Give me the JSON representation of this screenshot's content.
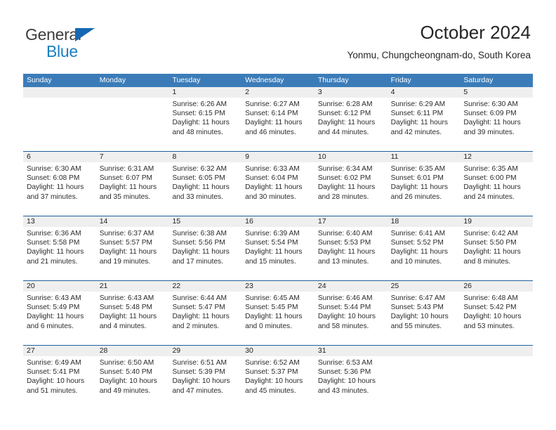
{
  "brand": {
    "name_part1": "General",
    "name_part2": "Blue",
    "triangle_color": "#1668b3",
    "blue_text_color": "#1a7fc1"
  },
  "header": {
    "title": "October 2024",
    "subtitle": "Yonmu, Chungcheongnam-do, South Korea"
  },
  "colors": {
    "header_blue": "#3b7cb8",
    "week_divider": "#20619e",
    "daynum_band": "#efefef"
  },
  "weekdays": [
    "Sunday",
    "Monday",
    "Tuesday",
    "Wednesday",
    "Thursday",
    "Friday",
    "Saturday"
  ],
  "weeks": [
    [
      {
        "day": "",
        "sunrise": "",
        "sunset": "",
        "daylight1": "",
        "daylight2": ""
      },
      {
        "day": "",
        "sunrise": "",
        "sunset": "",
        "daylight1": "",
        "daylight2": ""
      },
      {
        "day": "1",
        "sunrise": "Sunrise: 6:26 AM",
        "sunset": "Sunset: 6:15 PM",
        "daylight1": "Daylight: 11 hours",
        "daylight2": "and 48 minutes."
      },
      {
        "day": "2",
        "sunrise": "Sunrise: 6:27 AM",
        "sunset": "Sunset: 6:14 PM",
        "daylight1": "Daylight: 11 hours",
        "daylight2": "and 46 minutes."
      },
      {
        "day": "3",
        "sunrise": "Sunrise: 6:28 AM",
        "sunset": "Sunset: 6:12 PM",
        "daylight1": "Daylight: 11 hours",
        "daylight2": "and 44 minutes."
      },
      {
        "day": "4",
        "sunrise": "Sunrise: 6:29 AM",
        "sunset": "Sunset: 6:11 PM",
        "daylight1": "Daylight: 11 hours",
        "daylight2": "and 42 minutes."
      },
      {
        "day": "5",
        "sunrise": "Sunrise: 6:30 AM",
        "sunset": "Sunset: 6:09 PM",
        "daylight1": "Daylight: 11 hours",
        "daylight2": "and 39 minutes."
      }
    ],
    [
      {
        "day": "6",
        "sunrise": "Sunrise: 6:30 AM",
        "sunset": "Sunset: 6:08 PM",
        "daylight1": "Daylight: 11 hours",
        "daylight2": "and 37 minutes."
      },
      {
        "day": "7",
        "sunrise": "Sunrise: 6:31 AM",
        "sunset": "Sunset: 6:07 PM",
        "daylight1": "Daylight: 11 hours",
        "daylight2": "and 35 minutes."
      },
      {
        "day": "8",
        "sunrise": "Sunrise: 6:32 AM",
        "sunset": "Sunset: 6:05 PM",
        "daylight1": "Daylight: 11 hours",
        "daylight2": "and 33 minutes."
      },
      {
        "day": "9",
        "sunrise": "Sunrise: 6:33 AM",
        "sunset": "Sunset: 6:04 PM",
        "daylight1": "Daylight: 11 hours",
        "daylight2": "and 30 minutes."
      },
      {
        "day": "10",
        "sunrise": "Sunrise: 6:34 AM",
        "sunset": "Sunset: 6:02 PM",
        "daylight1": "Daylight: 11 hours",
        "daylight2": "and 28 minutes."
      },
      {
        "day": "11",
        "sunrise": "Sunrise: 6:35 AM",
        "sunset": "Sunset: 6:01 PM",
        "daylight1": "Daylight: 11 hours",
        "daylight2": "and 26 minutes."
      },
      {
        "day": "12",
        "sunrise": "Sunrise: 6:35 AM",
        "sunset": "Sunset: 6:00 PM",
        "daylight1": "Daylight: 11 hours",
        "daylight2": "and 24 minutes."
      }
    ],
    [
      {
        "day": "13",
        "sunrise": "Sunrise: 6:36 AM",
        "sunset": "Sunset: 5:58 PM",
        "daylight1": "Daylight: 11 hours",
        "daylight2": "and 21 minutes."
      },
      {
        "day": "14",
        "sunrise": "Sunrise: 6:37 AM",
        "sunset": "Sunset: 5:57 PM",
        "daylight1": "Daylight: 11 hours",
        "daylight2": "and 19 minutes."
      },
      {
        "day": "15",
        "sunrise": "Sunrise: 6:38 AM",
        "sunset": "Sunset: 5:56 PM",
        "daylight1": "Daylight: 11 hours",
        "daylight2": "and 17 minutes."
      },
      {
        "day": "16",
        "sunrise": "Sunrise: 6:39 AM",
        "sunset": "Sunset: 5:54 PM",
        "daylight1": "Daylight: 11 hours",
        "daylight2": "and 15 minutes."
      },
      {
        "day": "17",
        "sunrise": "Sunrise: 6:40 AM",
        "sunset": "Sunset: 5:53 PM",
        "daylight1": "Daylight: 11 hours",
        "daylight2": "and 13 minutes."
      },
      {
        "day": "18",
        "sunrise": "Sunrise: 6:41 AM",
        "sunset": "Sunset: 5:52 PM",
        "daylight1": "Daylight: 11 hours",
        "daylight2": "and 10 minutes."
      },
      {
        "day": "19",
        "sunrise": "Sunrise: 6:42 AM",
        "sunset": "Sunset: 5:50 PM",
        "daylight1": "Daylight: 11 hours",
        "daylight2": "and 8 minutes."
      }
    ],
    [
      {
        "day": "20",
        "sunrise": "Sunrise: 6:43 AM",
        "sunset": "Sunset: 5:49 PM",
        "daylight1": "Daylight: 11 hours",
        "daylight2": "and 6 minutes."
      },
      {
        "day": "21",
        "sunrise": "Sunrise: 6:43 AM",
        "sunset": "Sunset: 5:48 PM",
        "daylight1": "Daylight: 11 hours",
        "daylight2": "and 4 minutes."
      },
      {
        "day": "22",
        "sunrise": "Sunrise: 6:44 AM",
        "sunset": "Sunset: 5:47 PM",
        "daylight1": "Daylight: 11 hours",
        "daylight2": "and 2 minutes."
      },
      {
        "day": "23",
        "sunrise": "Sunrise: 6:45 AM",
        "sunset": "Sunset: 5:45 PM",
        "daylight1": "Daylight: 11 hours",
        "daylight2": "and 0 minutes."
      },
      {
        "day": "24",
        "sunrise": "Sunrise: 6:46 AM",
        "sunset": "Sunset: 5:44 PM",
        "daylight1": "Daylight: 10 hours",
        "daylight2": "and 58 minutes."
      },
      {
        "day": "25",
        "sunrise": "Sunrise: 6:47 AM",
        "sunset": "Sunset: 5:43 PM",
        "daylight1": "Daylight: 10 hours",
        "daylight2": "and 55 minutes."
      },
      {
        "day": "26",
        "sunrise": "Sunrise: 6:48 AM",
        "sunset": "Sunset: 5:42 PM",
        "daylight1": "Daylight: 10 hours",
        "daylight2": "and 53 minutes."
      }
    ],
    [
      {
        "day": "27",
        "sunrise": "Sunrise: 6:49 AM",
        "sunset": "Sunset: 5:41 PM",
        "daylight1": "Daylight: 10 hours",
        "daylight2": "and 51 minutes."
      },
      {
        "day": "28",
        "sunrise": "Sunrise: 6:50 AM",
        "sunset": "Sunset: 5:40 PM",
        "daylight1": "Daylight: 10 hours",
        "daylight2": "and 49 minutes."
      },
      {
        "day": "29",
        "sunrise": "Sunrise: 6:51 AM",
        "sunset": "Sunset: 5:39 PM",
        "daylight1": "Daylight: 10 hours",
        "daylight2": "and 47 minutes."
      },
      {
        "day": "30",
        "sunrise": "Sunrise: 6:52 AM",
        "sunset": "Sunset: 5:37 PM",
        "daylight1": "Daylight: 10 hours",
        "daylight2": "and 45 minutes."
      },
      {
        "day": "31",
        "sunrise": "Sunrise: 6:53 AM",
        "sunset": "Sunset: 5:36 PM",
        "daylight1": "Daylight: 10 hours",
        "daylight2": "and 43 minutes."
      },
      {
        "day": "",
        "sunrise": "",
        "sunset": "",
        "daylight1": "",
        "daylight2": ""
      },
      {
        "day": "",
        "sunrise": "",
        "sunset": "",
        "daylight1": "",
        "daylight2": ""
      }
    ]
  ]
}
